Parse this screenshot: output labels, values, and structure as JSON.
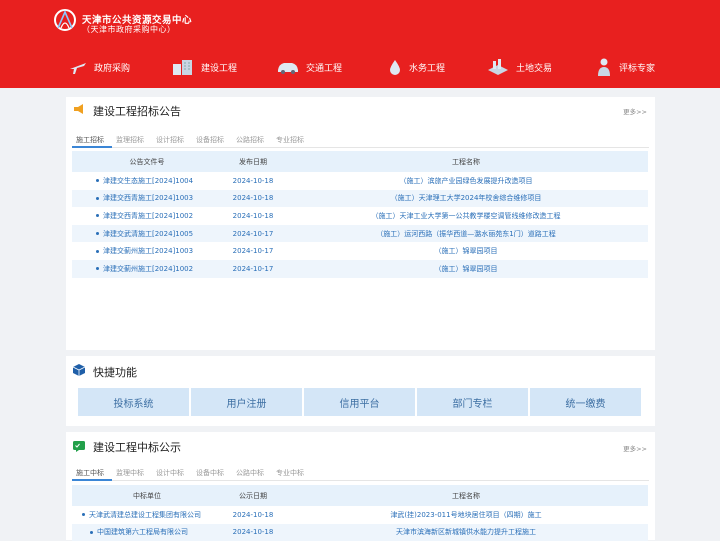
{
  "site": {
    "title": "天津市公共资源交易中心",
    "subtitle": "（天津市政府采购中心）"
  },
  "nav": [
    {
      "label": "政府采购",
      "icon": "plane-icon"
    },
    {
      "label": "建设工程",
      "icon": "building-icon"
    },
    {
      "label": "交通工程",
      "icon": "car-icon"
    },
    {
      "label": "水务工程",
      "icon": "water-drop-icon"
    },
    {
      "label": "土地交易",
      "icon": "land-icon"
    },
    {
      "label": "评标专家",
      "icon": "expert-icon"
    }
  ],
  "tender": {
    "title": "建设工程招标公告",
    "more": "更多>>",
    "tabs": [
      "施工招标",
      "监理招标",
      "设计招标",
      "设备招标",
      "公路招标",
      "专业招标"
    ],
    "headers": [
      "公告文件号",
      "发布日期",
      "工程名称"
    ],
    "rows": [
      {
        "code": "津建交生态施工[2024]1004",
        "date": "2024-10-18",
        "name": "（施工）滨旅产业园绿色发展提升改造项目"
      },
      {
        "code": "津建交西青施工[2024]1003",
        "date": "2024-10-18",
        "name": "（施工）天津理工大学2024年校舍综合维修项目"
      },
      {
        "code": "津建交西青施工[2024]1002",
        "date": "2024-10-18",
        "name": "（施工）天津工业大学第一公共教学楼空调管线维修改造工程"
      },
      {
        "code": "津建交武清施工[2024]1005",
        "date": "2024-10-17",
        "name": "（施工）运河西路（振华西道—潞水丽苑东1门）道路工程"
      },
      {
        "code": "津建交蓟州施工[2024]1003",
        "date": "2024-10-17",
        "name": "（施工）锦翠园项目"
      },
      {
        "code": "津建交蓟州施工[2024]1002",
        "date": "2024-10-17",
        "name": "（施工）锦翠园项目"
      }
    ]
  },
  "quick": {
    "title": "快捷功能",
    "buttons": [
      "投标系统",
      "用户注册",
      "信用平台",
      "部门专栏",
      "统一缴费"
    ]
  },
  "award": {
    "title": "建设工程中标公示",
    "more": "更多>>",
    "tabs": [
      "施工中标",
      "监理中标",
      "设计中标",
      "设备中标",
      "公路中标",
      "专业中标"
    ],
    "headers": [
      "中标单位",
      "公示日期",
      "工程名称"
    ],
    "rows": [
      {
        "code": "天津武清建总建设工程集团有限公司",
        "date": "2024-10-18",
        "name": "津武(挂)2023-011号地块居住项目（四期）施工"
      },
      {
        "code": "中国建筑第六工程局有限公司",
        "date": "2024-10-18",
        "name": "天津市滨海新区新城镇供水能力提升工程施工"
      }
    ]
  },
  "colors": {
    "header": "#e8201f",
    "accent": "#3b86d6",
    "link": "#2a6fb8",
    "quick_bg": "#d4e6f7"
  }
}
